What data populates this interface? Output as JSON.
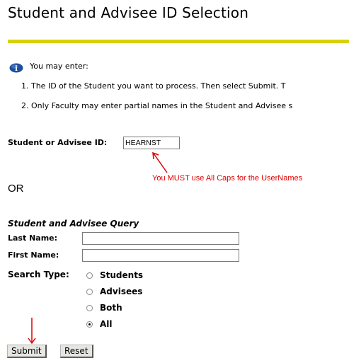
{
  "page": {
    "title": "Student and Advisee ID Selection",
    "colors": {
      "title_rule": "#d8d200",
      "note": "#e00000",
      "arrow": "#e00000"
    }
  },
  "info": {
    "icon": "info-icon",
    "intro": "You may enter:",
    "items": [
      "1. The ID of the Student you want to process. Then select Submit. T",
      "2. Only Faculty may enter partial names in the Student and Advisee s"
    ]
  },
  "id_form": {
    "label": "Student or Advisee ID:",
    "value": "HEARNST",
    "note": "You MUST use All Caps for the UserNames"
  },
  "or_text": "OR",
  "query": {
    "title": "Student and Advisee Query",
    "last_name_label": "Last Name:",
    "last_name_value": "",
    "first_name_label": "First Name:",
    "first_name_value": "",
    "search_type_label": "Search Type:",
    "options": [
      {
        "label": "Students",
        "checked": false
      },
      {
        "label": "Advisees",
        "checked": false
      },
      {
        "label": "Both",
        "checked": false
      },
      {
        "label": "All",
        "checked": true
      }
    ]
  },
  "buttons": {
    "submit": "Submit",
    "reset": "Reset"
  }
}
